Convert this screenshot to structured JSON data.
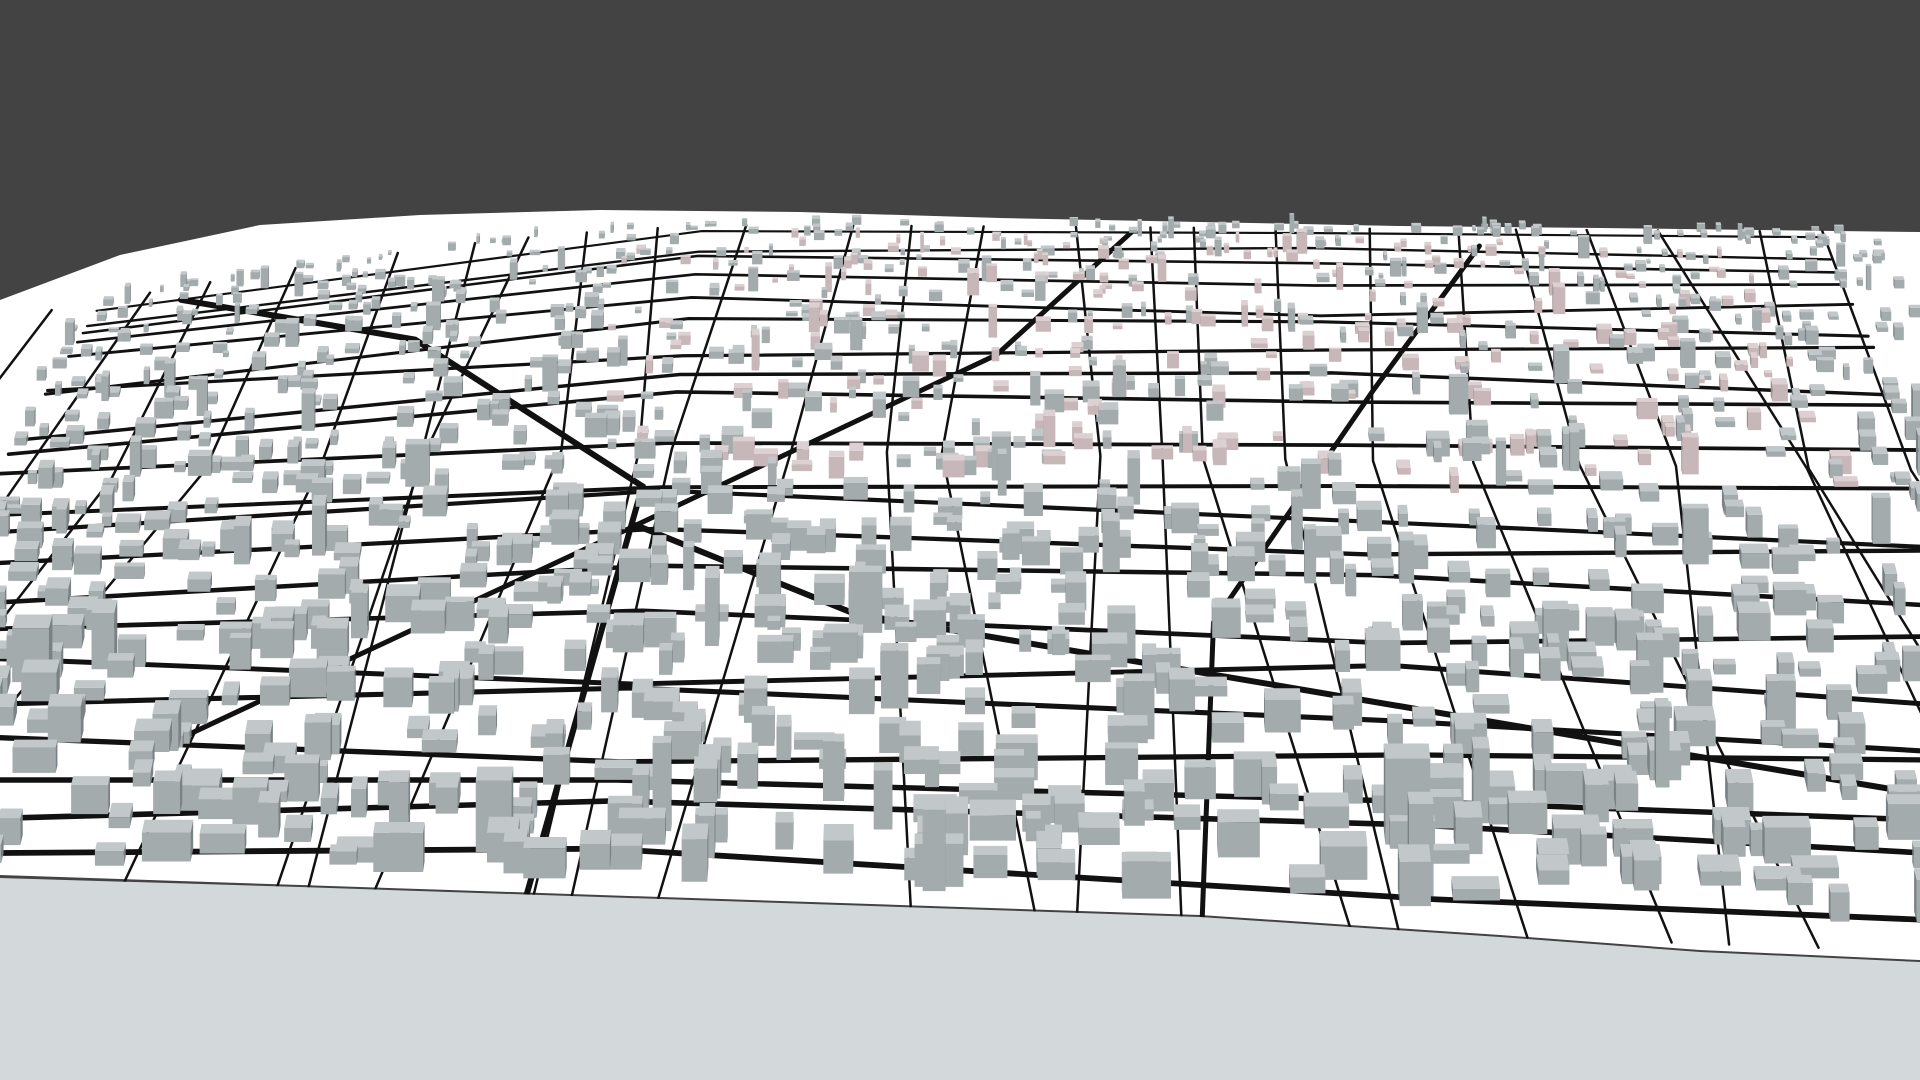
{
  "viewport": {
    "description_label": "",
    "colors": {
      "sky": "#434343",
      "ground": "#ffffff",
      "near_plane": "#d3d8da",
      "road": "#111111",
      "building_gray": "#a4abad",
      "building_gray_dark": "#7b8285",
      "building_gray_top": "#c2c7c9",
      "building_pink": "#c8b7b9",
      "building_pink_dark": "#9c8c8e",
      "building_pink_top": "#ddd0d2"
    },
    "icons": []
  }
}
